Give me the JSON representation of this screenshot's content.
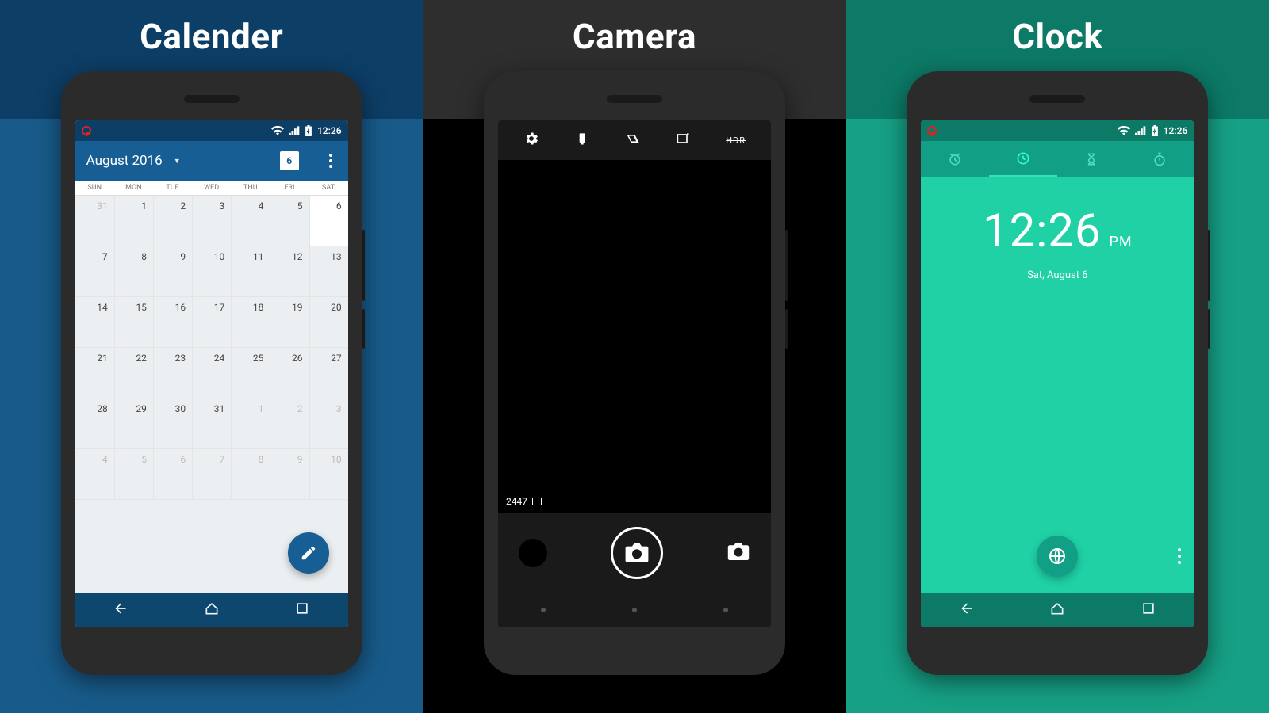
{
  "panels": {
    "calendar": "Calender",
    "camera": "Camera",
    "clock": "Clock"
  },
  "status": {
    "time": "12:26"
  },
  "calendar": {
    "month_label": "August 2016",
    "today_chip": "6",
    "dows": [
      "SUN",
      "MON",
      "TUE",
      "WED",
      "THU",
      "FRI",
      "SAT"
    ],
    "rows": [
      [
        {
          "n": "31",
          "muted": true
        },
        {
          "n": "1"
        },
        {
          "n": "2"
        },
        {
          "n": "3"
        },
        {
          "n": "4"
        },
        {
          "n": "5"
        },
        {
          "n": "6",
          "today": true
        }
      ],
      [
        {
          "n": "7"
        },
        {
          "n": "8"
        },
        {
          "n": "9"
        },
        {
          "n": "10"
        },
        {
          "n": "11"
        },
        {
          "n": "12"
        },
        {
          "n": "13"
        }
      ],
      [
        {
          "n": "14"
        },
        {
          "n": "15"
        },
        {
          "n": "16"
        },
        {
          "n": "17"
        },
        {
          "n": "18"
        },
        {
          "n": "19"
        },
        {
          "n": "20"
        }
      ],
      [
        {
          "n": "21"
        },
        {
          "n": "22"
        },
        {
          "n": "23"
        },
        {
          "n": "24"
        },
        {
          "n": "25"
        },
        {
          "n": "26"
        },
        {
          "n": "27"
        }
      ],
      [
        {
          "n": "28"
        },
        {
          "n": "29"
        },
        {
          "n": "30"
        },
        {
          "n": "31"
        },
        {
          "n": "1",
          "muted": true
        },
        {
          "n": "2",
          "muted": true
        },
        {
          "n": "3",
          "muted": true
        }
      ],
      [
        {
          "n": "4",
          "muted": true
        },
        {
          "n": "5",
          "muted": true
        },
        {
          "n": "6",
          "muted": true
        },
        {
          "n": "7",
          "muted": true
        },
        {
          "n": "8",
          "muted": true
        },
        {
          "n": "9",
          "muted": true
        },
        {
          "n": "10",
          "muted": true
        }
      ]
    ]
  },
  "camera": {
    "shots_remaining": "2447",
    "hdr_label": "HDR"
  },
  "clock": {
    "time": "12:26",
    "ampm": "PM",
    "date": "Sat, August 6"
  }
}
